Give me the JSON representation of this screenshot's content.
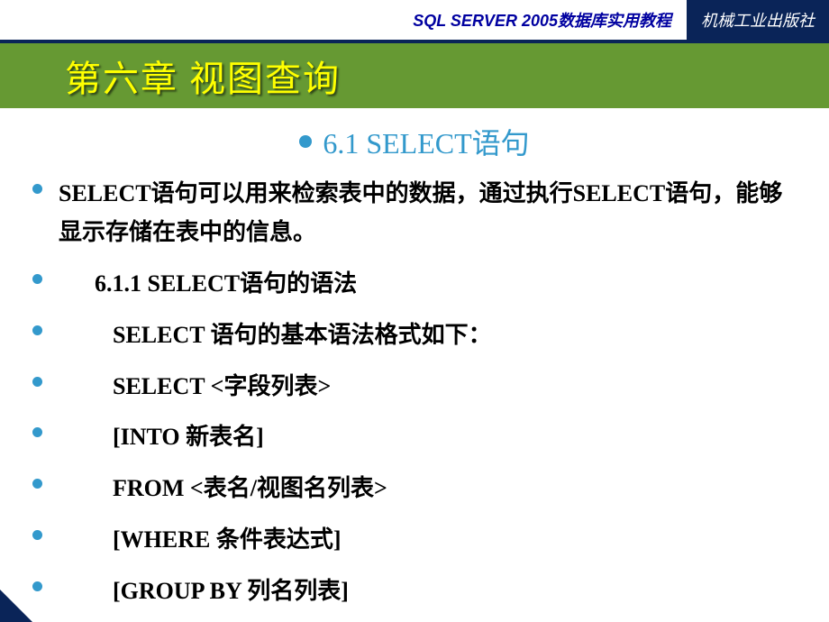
{
  "header": {
    "title": "SQL SERVER 2005数据库实用教程",
    "publisher": "机械工业出版社"
  },
  "chapter": {
    "title": "第六章  视图查询"
  },
  "section": {
    "number_title": "6.1  SELECT语句"
  },
  "lines": {
    "l1": "        SELECT语句可以用来检索表中的数据，通过执行SELECT语句，能够显示存储在表中的信息。",
    "l2": "6.1.1  SELECT语句的语法",
    "l3": "SELECT 语句的基本语法格式如下：",
    "l4": "SELECT <字段列表>",
    "l5": "[INTO 新表名]",
    "l6": "FROM <表名/视图名列表>",
    "l7": "[WHERE 条件表达式]",
    "l8": "[GROUP BY 列名列表]"
  }
}
